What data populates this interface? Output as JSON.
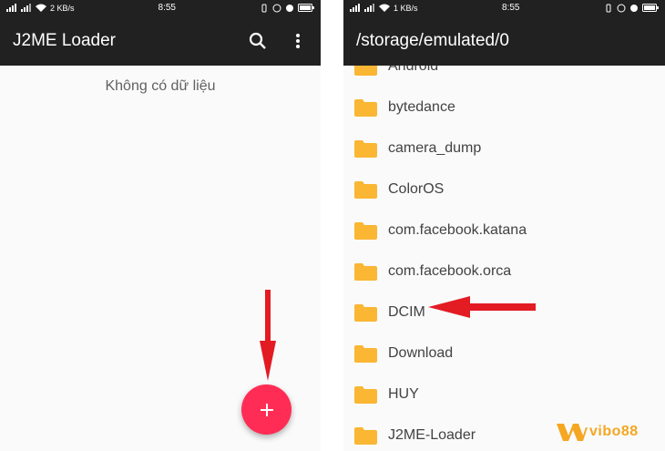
{
  "left_screen": {
    "status": {
      "signal": "4G",
      "speed": "2 KB/s",
      "time": "8:55"
    },
    "app_title": "J2ME Loader",
    "empty_message": "Không có dữ liệu",
    "fab_icon": "plus-icon"
  },
  "right_screen": {
    "status": {
      "signal": "4G",
      "speed": "1 KB/s",
      "time": "8:55"
    },
    "path_title": "/storage/emulated/0",
    "folders": [
      {
        "label": "Android"
      },
      {
        "label": "bytedance"
      },
      {
        "label": "camera_dump"
      },
      {
        "label": "ColorOS"
      },
      {
        "label": "com.facebook.katana"
      },
      {
        "label": "com.facebook.orca"
      },
      {
        "label": "DCIM"
      },
      {
        "label": "Download"
      },
      {
        "label": "HUY"
      },
      {
        "label": "J2ME-Loader"
      }
    ]
  },
  "watermark": {
    "text": "vibo88"
  },
  "colors": {
    "appbar": "#212121",
    "fab": "#ff2d55",
    "folder": "#fbb634",
    "arrow": "#e31b23",
    "watermark": "#f5a623"
  }
}
